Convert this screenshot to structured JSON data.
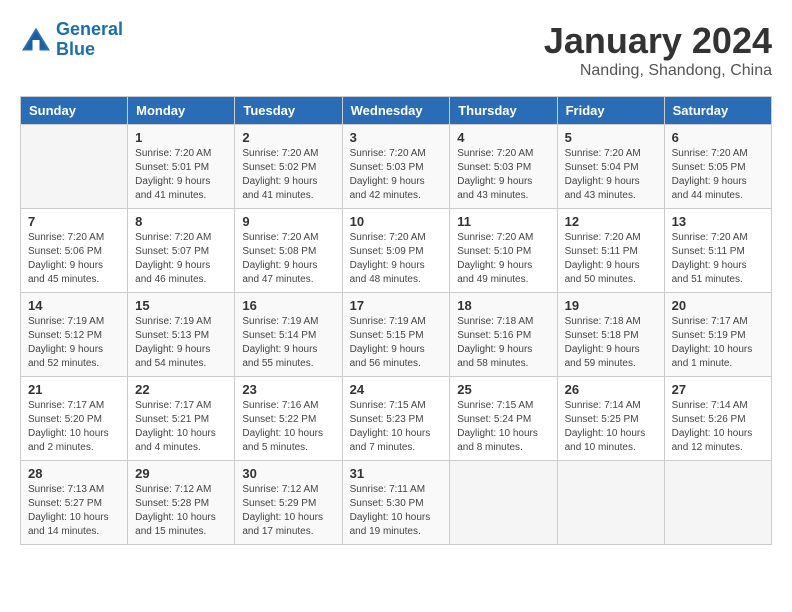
{
  "header": {
    "logo_line1": "General",
    "logo_line2": "Blue",
    "month_year": "January 2024",
    "location": "Nanding, Shandong, China"
  },
  "weekdays": [
    "Sunday",
    "Monday",
    "Tuesday",
    "Wednesday",
    "Thursday",
    "Friday",
    "Saturday"
  ],
  "weeks": [
    [
      {
        "day": "",
        "sunrise": "",
        "sunset": "",
        "daylight": ""
      },
      {
        "day": "1",
        "sunrise": "7:20 AM",
        "sunset": "5:01 PM",
        "daylight": "9 hours and 41 minutes."
      },
      {
        "day": "2",
        "sunrise": "7:20 AM",
        "sunset": "5:02 PM",
        "daylight": "9 hours and 41 minutes."
      },
      {
        "day": "3",
        "sunrise": "7:20 AM",
        "sunset": "5:03 PM",
        "daylight": "9 hours and 42 minutes."
      },
      {
        "day": "4",
        "sunrise": "7:20 AM",
        "sunset": "5:03 PM",
        "daylight": "9 hours and 43 minutes."
      },
      {
        "day": "5",
        "sunrise": "7:20 AM",
        "sunset": "5:04 PM",
        "daylight": "9 hours and 43 minutes."
      },
      {
        "day": "6",
        "sunrise": "7:20 AM",
        "sunset": "5:05 PM",
        "daylight": "9 hours and 44 minutes."
      }
    ],
    [
      {
        "day": "7",
        "sunrise": "7:20 AM",
        "sunset": "5:06 PM",
        "daylight": "9 hours and 45 minutes."
      },
      {
        "day": "8",
        "sunrise": "7:20 AM",
        "sunset": "5:07 PM",
        "daylight": "9 hours and 46 minutes."
      },
      {
        "day": "9",
        "sunrise": "7:20 AM",
        "sunset": "5:08 PM",
        "daylight": "9 hours and 47 minutes."
      },
      {
        "day": "10",
        "sunrise": "7:20 AM",
        "sunset": "5:09 PM",
        "daylight": "9 hours and 48 minutes."
      },
      {
        "day": "11",
        "sunrise": "7:20 AM",
        "sunset": "5:10 PM",
        "daylight": "9 hours and 49 minutes."
      },
      {
        "day": "12",
        "sunrise": "7:20 AM",
        "sunset": "5:11 PM",
        "daylight": "9 hours and 50 minutes."
      },
      {
        "day": "13",
        "sunrise": "7:20 AM",
        "sunset": "5:11 PM",
        "daylight": "9 hours and 51 minutes."
      }
    ],
    [
      {
        "day": "14",
        "sunrise": "7:19 AM",
        "sunset": "5:12 PM",
        "daylight": "9 hours and 52 minutes."
      },
      {
        "day": "15",
        "sunrise": "7:19 AM",
        "sunset": "5:13 PM",
        "daylight": "9 hours and 54 minutes."
      },
      {
        "day": "16",
        "sunrise": "7:19 AM",
        "sunset": "5:14 PM",
        "daylight": "9 hours and 55 minutes."
      },
      {
        "day": "17",
        "sunrise": "7:19 AM",
        "sunset": "5:15 PM",
        "daylight": "9 hours and 56 minutes."
      },
      {
        "day": "18",
        "sunrise": "7:18 AM",
        "sunset": "5:16 PM",
        "daylight": "9 hours and 58 minutes."
      },
      {
        "day": "19",
        "sunrise": "7:18 AM",
        "sunset": "5:18 PM",
        "daylight": "9 hours and 59 minutes."
      },
      {
        "day": "20",
        "sunrise": "7:17 AM",
        "sunset": "5:19 PM",
        "daylight": "10 hours and 1 minute."
      }
    ],
    [
      {
        "day": "21",
        "sunrise": "7:17 AM",
        "sunset": "5:20 PM",
        "daylight": "10 hours and 2 minutes."
      },
      {
        "day": "22",
        "sunrise": "7:17 AM",
        "sunset": "5:21 PM",
        "daylight": "10 hours and 4 minutes."
      },
      {
        "day": "23",
        "sunrise": "7:16 AM",
        "sunset": "5:22 PM",
        "daylight": "10 hours and 5 minutes."
      },
      {
        "day": "24",
        "sunrise": "7:15 AM",
        "sunset": "5:23 PM",
        "daylight": "10 hours and 7 minutes."
      },
      {
        "day": "25",
        "sunrise": "7:15 AM",
        "sunset": "5:24 PM",
        "daylight": "10 hours and 8 minutes."
      },
      {
        "day": "26",
        "sunrise": "7:14 AM",
        "sunset": "5:25 PM",
        "daylight": "10 hours and 10 minutes."
      },
      {
        "day": "27",
        "sunrise": "7:14 AM",
        "sunset": "5:26 PM",
        "daylight": "10 hours and 12 minutes."
      }
    ],
    [
      {
        "day": "28",
        "sunrise": "7:13 AM",
        "sunset": "5:27 PM",
        "daylight": "10 hours and 14 minutes."
      },
      {
        "day": "29",
        "sunrise": "7:12 AM",
        "sunset": "5:28 PM",
        "daylight": "10 hours and 15 minutes."
      },
      {
        "day": "30",
        "sunrise": "7:12 AM",
        "sunset": "5:29 PM",
        "daylight": "10 hours and 17 minutes."
      },
      {
        "day": "31",
        "sunrise": "7:11 AM",
        "sunset": "5:30 PM",
        "daylight": "10 hours and 19 minutes."
      },
      {
        "day": "",
        "sunrise": "",
        "sunset": "",
        "daylight": ""
      },
      {
        "day": "",
        "sunrise": "",
        "sunset": "",
        "daylight": ""
      },
      {
        "day": "",
        "sunrise": "",
        "sunset": "",
        "daylight": ""
      }
    ]
  ]
}
